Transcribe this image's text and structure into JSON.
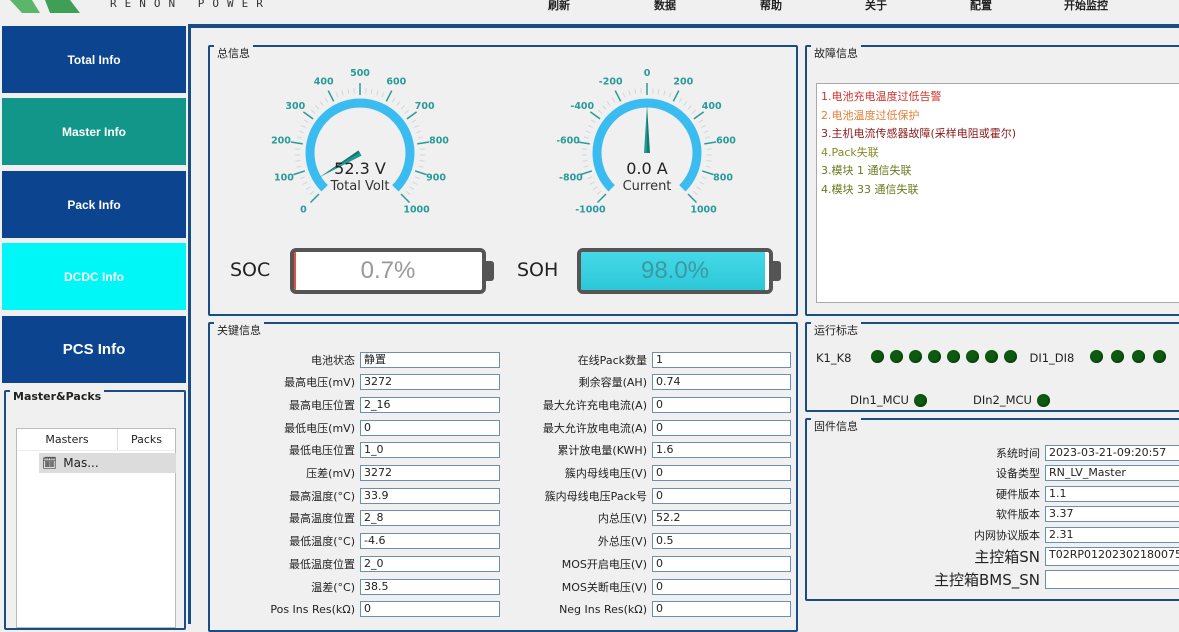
{
  "brand": {
    "name": "RENON POWER",
    "logo_color": "#4caf50"
  },
  "menu": [
    "刷新",
    "数据",
    "帮助",
    "关于",
    "配置",
    "开始监控"
  ],
  "nav": [
    {
      "label": "Total Info",
      "color": "#0d4490"
    },
    {
      "label": "Master Info",
      "color": "#13968a"
    },
    {
      "label": "Pack Info",
      "color": "#0d4490"
    },
    {
      "label": "DCDC Info",
      "color": "#00f7f7"
    },
    {
      "label": "PCS Info",
      "color": "#0d4490"
    }
  ],
  "tree": {
    "title": "Master&Packs",
    "columns": [
      "Masters",
      "Packs"
    ],
    "items": [
      "Mas..."
    ]
  },
  "total": {
    "title": "总信息",
    "volt": {
      "value": 52.3,
      "text": "52.3 V",
      "label": "Total Volt",
      "min": 0,
      "max": 1000,
      "ticks": [
        0,
        100,
        200,
        300,
        400,
        500,
        600,
        700,
        800,
        900,
        1000
      ]
    },
    "current": {
      "value": 0.0,
      "text": "0.0 A",
      "label": "Current",
      "min": -1000,
      "max": 1000,
      "ticks": [
        -1000,
        -800,
        -600,
        -400,
        -200,
        0,
        200,
        400,
        600,
        800,
        1000
      ]
    },
    "soc": {
      "label": "SOC",
      "value": 0.7,
      "text": "0.7%"
    },
    "soh": {
      "label": "SOH",
      "value": 98.0,
      "text": "98.0%"
    }
  },
  "faults": {
    "title": "故障信息",
    "items": [
      {
        "text": "1.电池充电温度过低告警",
        "color": "#d0342c"
      },
      {
        "text": "2.电池温度过低保护",
        "color": "#e0803a"
      },
      {
        "text": "3.主机电流传感器故障(采样电阻或霍尔)",
        "color": "#8b1a1a"
      },
      {
        "text": "4.Pack失联",
        "color": "#8a8a2a"
      },
      {
        "text": "3.模块 1 通信失联",
        "color": "#6b7a20"
      },
      {
        "text": "4.模块 33 通信失联",
        "color": "#6b7a20"
      }
    ]
  },
  "key": {
    "title": "关键信息",
    "left": [
      [
        "电池状态",
        "静置"
      ],
      [
        "最高电压(mV)",
        "3272"
      ],
      [
        "最高电压位置",
        "2_16"
      ],
      [
        "最低电压(mV)",
        "0"
      ],
      [
        "最低电压位置",
        "1_0"
      ],
      [
        "压差(mV)",
        "3272"
      ],
      [
        "最高温度(°C)",
        "33.9"
      ],
      [
        "最高温度位置",
        "2_8"
      ],
      [
        "最低温度(°C)",
        "-4.6"
      ],
      [
        "最低温度位置",
        "2_0"
      ],
      [
        "温差(°C)",
        "38.5"
      ],
      [
        "Pos Ins Res(kΩ)",
        "0"
      ]
    ],
    "right": [
      [
        "在线Pack数量",
        "1"
      ],
      [
        "剩余容量(AH)",
        "0.74"
      ],
      [
        "最大允许充电电流(A)",
        "0"
      ],
      [
        "最大允许放电电流(A)",
        "0"
      ],
      [
        "累计放电量(KWH)",
        "1.6"
      ],
      [
        "簇内母线电压(V)",
        "0"
      ],
      [
        "簇内母线电压Pack号",
        "0"
      ],
      [
        "内总压(V)",
        "52.2"
      ],
      [
        "外总压(V)",
        "0.5"
      ],
      [
        "MOS开启电压(V)",
        "0"
      ],
      [
        "MOS关断电压(V)",
        "0"
      ],
      [
        "Neg Ins Res(kΩ)",
        "0"
      ]
    ]
  },
  "run": {
    "title": "运行标志",
    "k_label": "K1_K8",
    "k_count": 8,
    "di_label": "DI1_DI8",
    "di_count": 4,
    "din1": "DIn1_MCU",
    "din2": "DIn2_MCU",
    "led_color": "#0d5a10"
  },
  "fw": {
    "title": "固件信息",
    "rows": [
      [
        "系统时间",
        "2023-03-21-09:20:57"
      ],
      [
        "设备类型",
        "RN_LV_Master"
      ],
      [
        "硬件版本",
        "1.1"
      ],
      [
        "软件版本",
        "3.37"
      ],
      [
        "内网协议版本",
        "2.31"
      ],
      [
        "主控箱SN",
        "T02RP01202302180075"
      ],
      [
        "主控箱BMS_SN",
        ""
      ]
    ]
  }
}
